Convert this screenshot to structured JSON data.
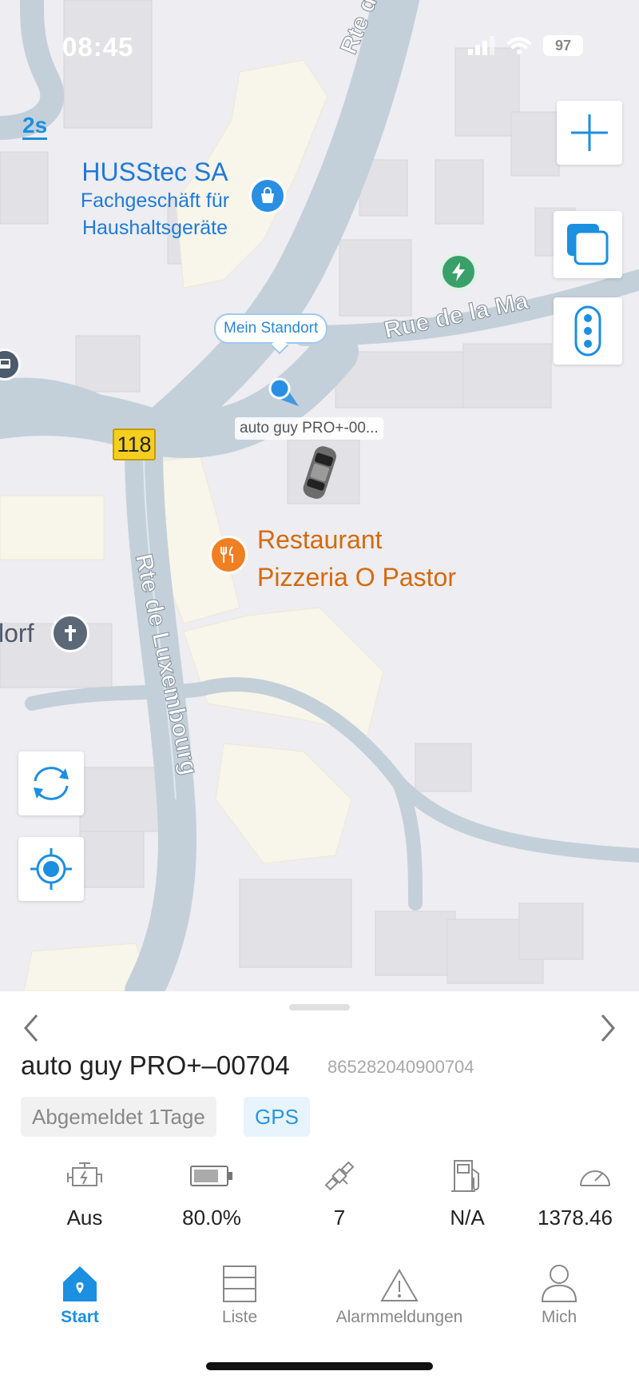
{
  "status_bar": {
    "time": "08:45",
    "battery": "97"
  },
  "map": {
    "scale_label": "2s",
    "road_labels": {
      "rte_echternach": "Rte d'Ech",
      "rue_de_la_ma": "Rue de la Ma",
      "rte_de_luxembourg": "Rte de Luxembourg",
      "route_number": "118"
    },
    "poi": {
      "husstec_name": "HUSStec SA",
      "husstec_line1": "Fachgeschäft für",
      "husstec_line2": "Haushaltsgeräte",
      "restaurant_line1": "Restaurant",
      "restaurant_line2": "Pizzeria O Pastor",
      "church_partial": "lorf"
    },
    "my_location_callout": "Mein Standort",
    "device_label": "auto guy PRO+-00...",
    "colors": {
      "accent": "#1b8fe0",
      "restaurant": "#d46a0c",
      "charger": "#3aa06a"
    }
  },
  "panel": {
    "device_name": "auto guy PRO+–00704",
    "imei": "865282040900704",
    "status_tag": "Abgemeldet 1Tage",
    "mode_tag": "GPS",
    "stats": {
      "engine": "Aus",
      "battery": "80.0%",
      "satellites": "7",
      "fuel": "N/A",
      "mileage": "1378.46"
    }
  },
  "tabbar": {
    "start": "Start",
    "liste": "Liste",
    "alarms": "Alarmmeldungen",
    "mich": "Mich"
  }
}
